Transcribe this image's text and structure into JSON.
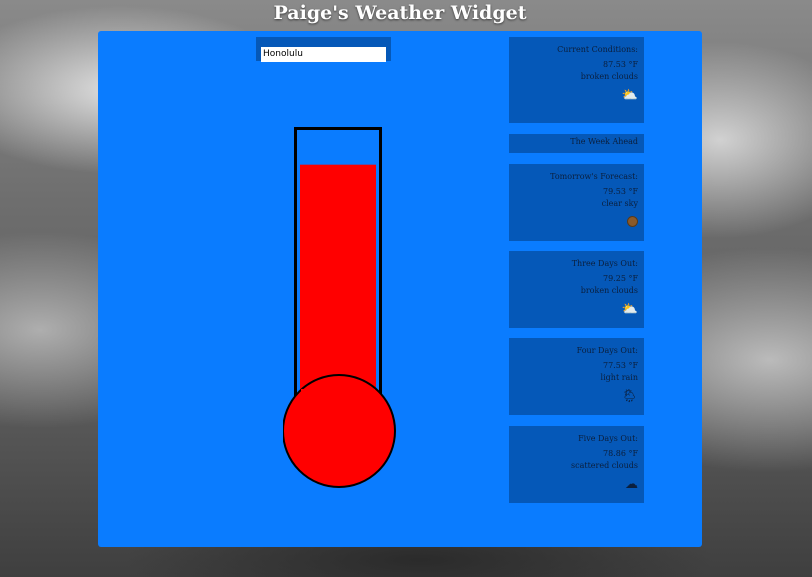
{
  "app": {
    "title": "Paige's Weather Widget"
  },
  "search": {
    "value": "Honolulu",
    "placeholder": ""
  },
  "thermometer": {
    "fill_fraction": 0.88,
    "fill_color": "#ff0000",
    "tube_color": "#000000"
  },
  "current": {
    "title": "Current Conditions:",
    "temp": "87.53 °F",
    "desc": "broken clouds",
    "icon": "broken-clouds-icon"
  },
  "week_header": "The Week Ahead",
  "forecast": [
    {
      "title": "Tomorrow's Forecast:",
      "temp": "79.53 °F",
      "desc": "clear sky",
      "icon": "clear-sky-icon"
    },
    {
      "title": "Three Days Out:",
      "temp": "79.25 °F",
      "desc": "broken clouds",
      "icon": "broken-clouds-icon"
    },
    {
      "title": "Four Days Out:",
      "temp": "77.53 °F",
      "desc": "light rain",
      "icon": "light-rain-icon"
    },
    {
      "title": "Five Days Out:",
      "temp": "78.86 °F",
      "desc": "scattered clouds",
      "icon": "scattered-clouds-icon"
    }
  ],
  "colors": {
    "widget_bg": "#0a7cff",
    "panel_bg": "#0558b8"
  }
}
